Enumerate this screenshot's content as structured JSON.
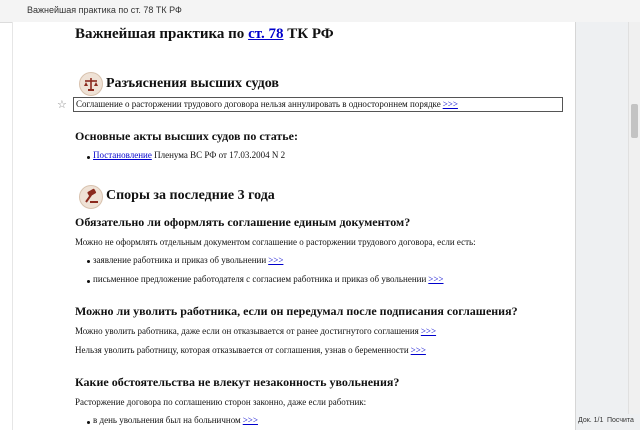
{
  "window": {
    "title": "Важнейшая практика по ст. 78 ТК РФ"
  },
  "page": {
    "title_prefix": "Важнейшая практика по",
    "title_link": "ст. 78",
    "title_suffix": "ТК РФ"
  },
  "section_courts": {
    "icon": "scales-icon",
    "heading": "Разъяснения высших судов",
    "highlight_text": "Соглашение о расторжении трудового договора нельзя аннулировать в одностороннем порядке",
    "more": ">>>",
    "acts_heading": "Основные акты высших судов по статье:",
    "acts": [
      {
        "link": "Постановление",
        "rest": "Пленума ВС РФ от 17.03.2004 N 2"
      }
    ]
  },
  "section_disputes": {
    "icon": "gavel-icon",
    "heading": "Споры за последние 3 года",
    "q1": {
      "heading": "Обязательно ли оформлять соглашение единым документом?",
      "intro": "Можно не оформлять отдельным документом соглашение о расторжении трудового договора, если есть:",
      "items": [
        {
          "text": "заявление работника и приказ об увольнении",
          "more": ">>>"
        },
        {
          "text": "письменное предложение работодателя с согласием работника и приказ об увольнении",
          "more": ">>>"
        }
      ]
    },
    "q2": {
      "heading": "Можно ли уволить работника, если он передумал после подписания соглашения?",
      "lines": [
        {
          "text": "Можно уволить работника, даже если он отказывается от ранее достигнутого соглашения",
          "more": ">>>"
        },
        {
          "text": "Нельзя уволить работницу, которая отказывается от соглашения, узнав о беременности",
          "more": ">>>"
        }
      ]
    },
    "q3": {
      "heading": "Какие обстоятельства не влекут незаконность увольнения?",
      "intro": "Расторжение договора по соглашению сторон законно, даже если работник:",
      "items": [
        {
          "text": "в день увольнения был на больничном",
          "more": ">>>"
        }
      ]
    }
  },
  "status": {
    "page": "Док. 1/1",
    "count_label": "Посчита"
  },
  "colors": {
    "link": "#0000cc",
    "icon_bg": "#efe2d6",
    "icon_fg": "#8b2a1e"
  }
}
